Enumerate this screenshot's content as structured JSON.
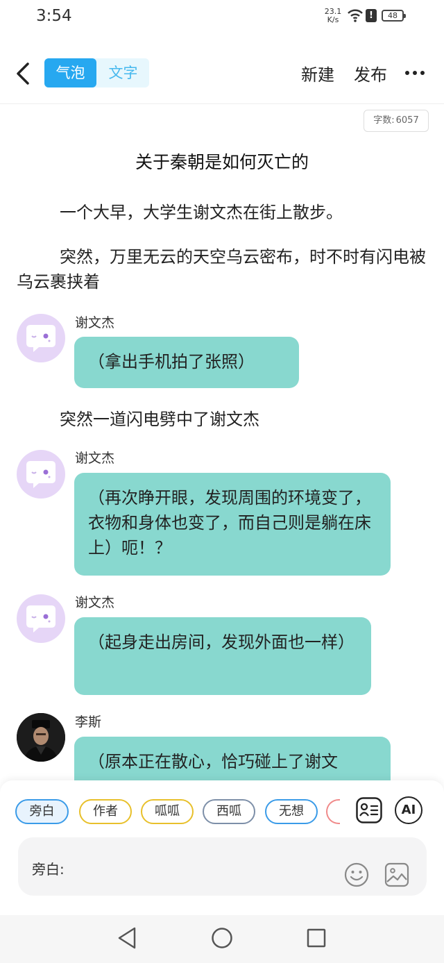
{
  "status": {
    "time": "3:54",
    "net_speed_value": "23.1",
    "net_speed_unit": "K/s",
    "battery": "48"
  },
  "header": {
    "tabs": [
      {
        "label": "气泡",
        "active": true
      },
      {
        "label": "文字",
        "active": false
      }
    ],
    "new_label": "新建",
    "publish_label": "发布"
  },
  "word_count": {
    "label": "字数:",
    "value": "6057"
  },
  "doc": {
    "title": "关于秦朝是如何灭亡的",
    "paragraphs": [
      "一个大早，大学生谢文杰在街上散步。",
      "突然，万里无云的天空乌云密布，时不时有闪电被乌云裹挟着",
      "突然一道闪电劈中了谢文杰"
    ],
    "messages": [
      {
        "speaker": "谢文杰",
        "text": "（拿出手机拍了张照）"
      },
      {
        "speaker": "谢文杰",
        "text": "（再次睁开眼，发现周围的环境变了，衣物和身体也变了，而自己则是躺在床上）呃！？"
      },
      {
        "speaker": "谢文杰",
        "text": "（起身走出房间，发现外面也一样）"
      },
      {
        "speaker": "李斯",
        "text": "（原本正在散心，恰巧碰上了谢文"
      }
    ]
  },
  "roles": [
    "旁白",
    "作者",
    "呱呱",
    "西呱",
    "无想"
  ],
  "ai_label": "AI",
  "input": {
    "prefix": "旁白:"
  },
  "colors": {
    "accent": "#27a8f0",
    "bubble": "#88d8cf",
    "avatar_bg": "#e6d6f7"
  },
  "icons": [
    "back-icon",
    "more-icon",
    "wifi-icon",
    "role-card-icon",
    "emoji-icon",
    "image-icon",
    "nav-back-icon",
    "nav-home-icon",
    "nav-recent-icon"
  ]
}
